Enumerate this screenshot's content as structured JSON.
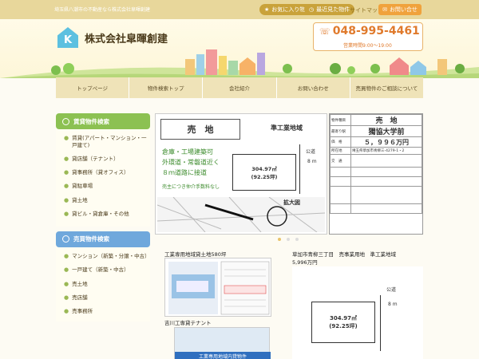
{
  "topbar": {
    "tagline": "埼玉県八潮市の不動産なら株式会社皐暉創建",
    "favorites": "お気に入り物件",
    "recent": "最近見た物件",
    "sitemap": "サイトマップ",
    "inquiry": "お問い合せ"
  },
  "header": {
    "logo_letter": "K",
    "company": "株式会社皐暉創建",
    "phone": "048-995-4461",
    "hours": "営業時間9:00～19:00"
  },
  "nav": [
    "トップページ",
    "物件検索トップ",
    "会社紹介",
    "お問い合わせ",
    "売買物件のご相談について"
  ],
  "rental": {
    "title": "賃貸物件検索",
    "items": [
      "賃貸(アパート・マンション・一戸建て)",
      "貸店舗（テナント）",
      "貸事務所（貸オフィス）",
      "貸駐車場",
      "貸土地",
      "貸ビル・貸倉庫・その他"
    ]
  },
  "sale": {
    "title": "売買物件検索",
    "items": [
      "マンション（新築・分譲・中古）",
      "一戸建て（新築・中古）",
      "売土地",
      "売店舗",
      "売事務所"
    ]
  },
  "slide": {
    "title": "売　地",
    "zone": "準工業地域",
    "desc": [
      "倉庫・工場建築可",
      "外環道・常磐道近く",
      "８ｍ道路に接道"
    ],
    "note": "売主につき仲介手数料なし",
    "area": "304.97㎡",
    "tsubo": "(92.25坪)",
    "road": "公道",
    "road_w": "8 m",
    "zoom": "拡大図"
  },
  "sheet": {
    "type": "物件種目",
    "kind": "売　地",
    "near_label": "最寄り駅",
    "station": "獨協大学前",
    "price_label": "価　格",
    "price": "５，９９６万円",
    "addr_label": "所在地",
    "addr": "埼玉県草加市青柳三-4279-1・2",
    "traffic_label": "交　通"
  },
  "cards": [
    {
      "title": "工業専用地域貸土地580坪"
    },
    {
      "title": "草加市青柳三丁目　売事業用地　準工業地域",
      "sub": "5,996万円",
      "area": "304.97㎡",
      "tsubo": "(92.25坪)",
      "road": "公道",
      "road_w": "8 m"
    },
    {
      "title": "吉川工専貸テナント",
      "banner": "工業専用地域内貸物件"
    }
  ],
  "colors": {
    "accent": "#e07a2c",
    "green": "#8cc152",
    "blue": "#6fa8dc",
    "nav_bg": "#efe3b8"
  }
}
